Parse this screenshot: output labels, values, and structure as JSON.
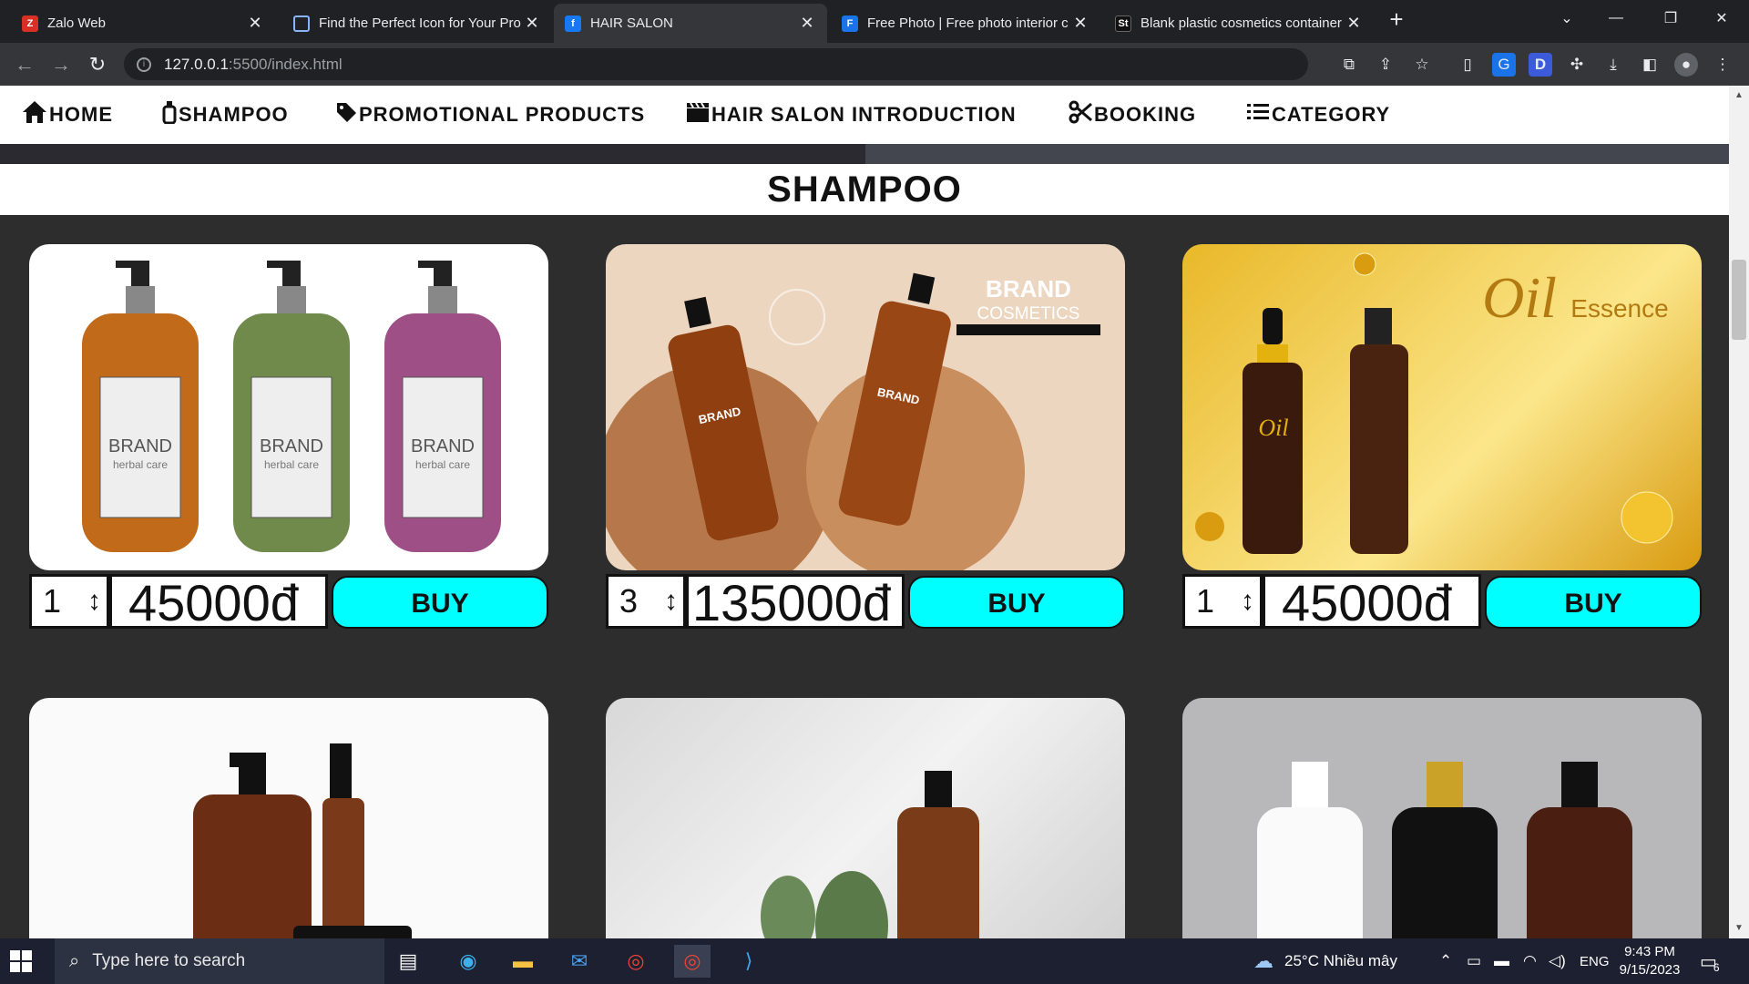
{
  "browser": {
    "tabs": [
      {
        "title": "Zalo Web",
        "favicon": "zalo-icon",
        "color": "#d93025",
        "active": false
      },
      {
        "title": "Find the Perfect Icon for Your Pro",
        "favicon": "flag-icon",
        "color": "#8ab4f8",
        "active": false
      },
      {
        "title": "HAIR SALON",
        "favicon": "facebook-icon",
        "color": "#1877f2",
        "active": true
      },
      {
        "title": "Free Photo | Free photo interior c",
        "favicon": "freepik-icon",
        "color": "#1a73e8",
        "active": false
      },
      {
        "title": "Blank plastic cosmetics container",
        "favicon": "stock-icon",
        "color": "#202124",
        "active": false
      }
    ],
    "url_host": "127.0.0.1",
    "url_path": ":5500/index.html"
  },
  "nav": {
    "items": [
      {
        "label": "HOME",
        "icon": "home-icon"
      },
      {
        "label": "SHAMPOO",
        "icon": "bottle-icon"
      },
      {
        "label": "PROMOTIONAL PRODUCTS",
        "icon": "tag-icon"
      },
      {
        "label": "HAIR SALON INTRODUCTION",
        "icon": "clapperboard-icon"
      },
      {
        "label": "BOOKING",
        "icon": "scissors-icon"
      },
      {
        "label": "CATEGORY",
        "icon": "list-icon"
      }
    ]
  },
  "section": {
    "title": "SHAMPOO"
  },
  "products": [
    {
      "qty": "1",
      "price": "45000đ",
      "buy": "BUY",
      "brand": "BRAND",
      "sub": "herbal care"
    },
    {
      "qty": "3",
      "price": "135000đ",
      "buy": "BUY",
      "brand": "BRAND",
      "sub": "COSMETICS"
    },
    {
      "qty": "1",
      "price": "45000đ",
      "buy": "BUY",
      "brand": "Oil",
      "sub": "Essence"
    }
  ],
  "taskbar": {
    "search_placeholder": "Type here to search",
    "weather": "25°C  Nhiều mây",
    "lang": "ENG",
    "time": "9:43 PM",
    "date": "9/15/2023",
    "notifications": "6"
  }
}
